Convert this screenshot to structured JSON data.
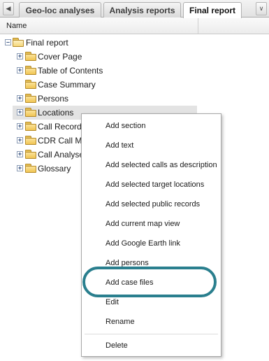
{
  "tabs": {
    "items": [
      {
        "label": "Geo-loc analyses"
      },
      {
        "label": "Analysis reports"
      },
      {
        "label": "Final report"
      }
    ],
    "active": "Final report"
  },
  "header": {
    "name_column": "Name"
  },
  "tree": {
    "root": {
      "label": "Final report",
      "expanded": true
    },
    "children": [
      {
        "label": "Cover Page",
        "expandable": true
      },
      {
        "label": "Table of Contents",
        "expandable": true
      },
      {
        "label": "Case Summary",
        "expandable": false
      },
      {
        "label": "Persons",
        "expandable": true
      },
      {
        "label": "Locations",
        "expandable": true,
        "selected": true
      },
      {
        "label": "Call Records",
        "expandable": true
      },
      {
        "label": "CDR Call Map",
        "expandable": true
      },
      {
        "label": "Call Analyses",
        "expandable": true
      },
      {
        "label": "Glossary",
        "expandable": true
      }
    ]
  },
  "context_menu": {
    "items": [
      {
        "label": "Add section"
      },
      {
        "label": "Add text"
      },
      {
        "label": "Add selected calls as description"
      },
      {
        "label": "Add selected target locations"
      },
      {
        "label": "Add selected public records"
      },
      {
        "label": "Add current map view"
      },
      {
        "label": "Add Google Earth link"
      },
      {
        "label": "Add persons"
      },
      {
        "label": "Add case files",
        "highlighted": true
      },
      {
        "label": "Edit"
      },
      {
        "label": "Rename"
      },
      {
        "label": "Delete"
      }
    ]
  },
  "colors": {
    "highlight_ring": "#2a7f8e",
    "selected_row": "#e3e3e3",
    "folder": "#f0c453"
  }
}
